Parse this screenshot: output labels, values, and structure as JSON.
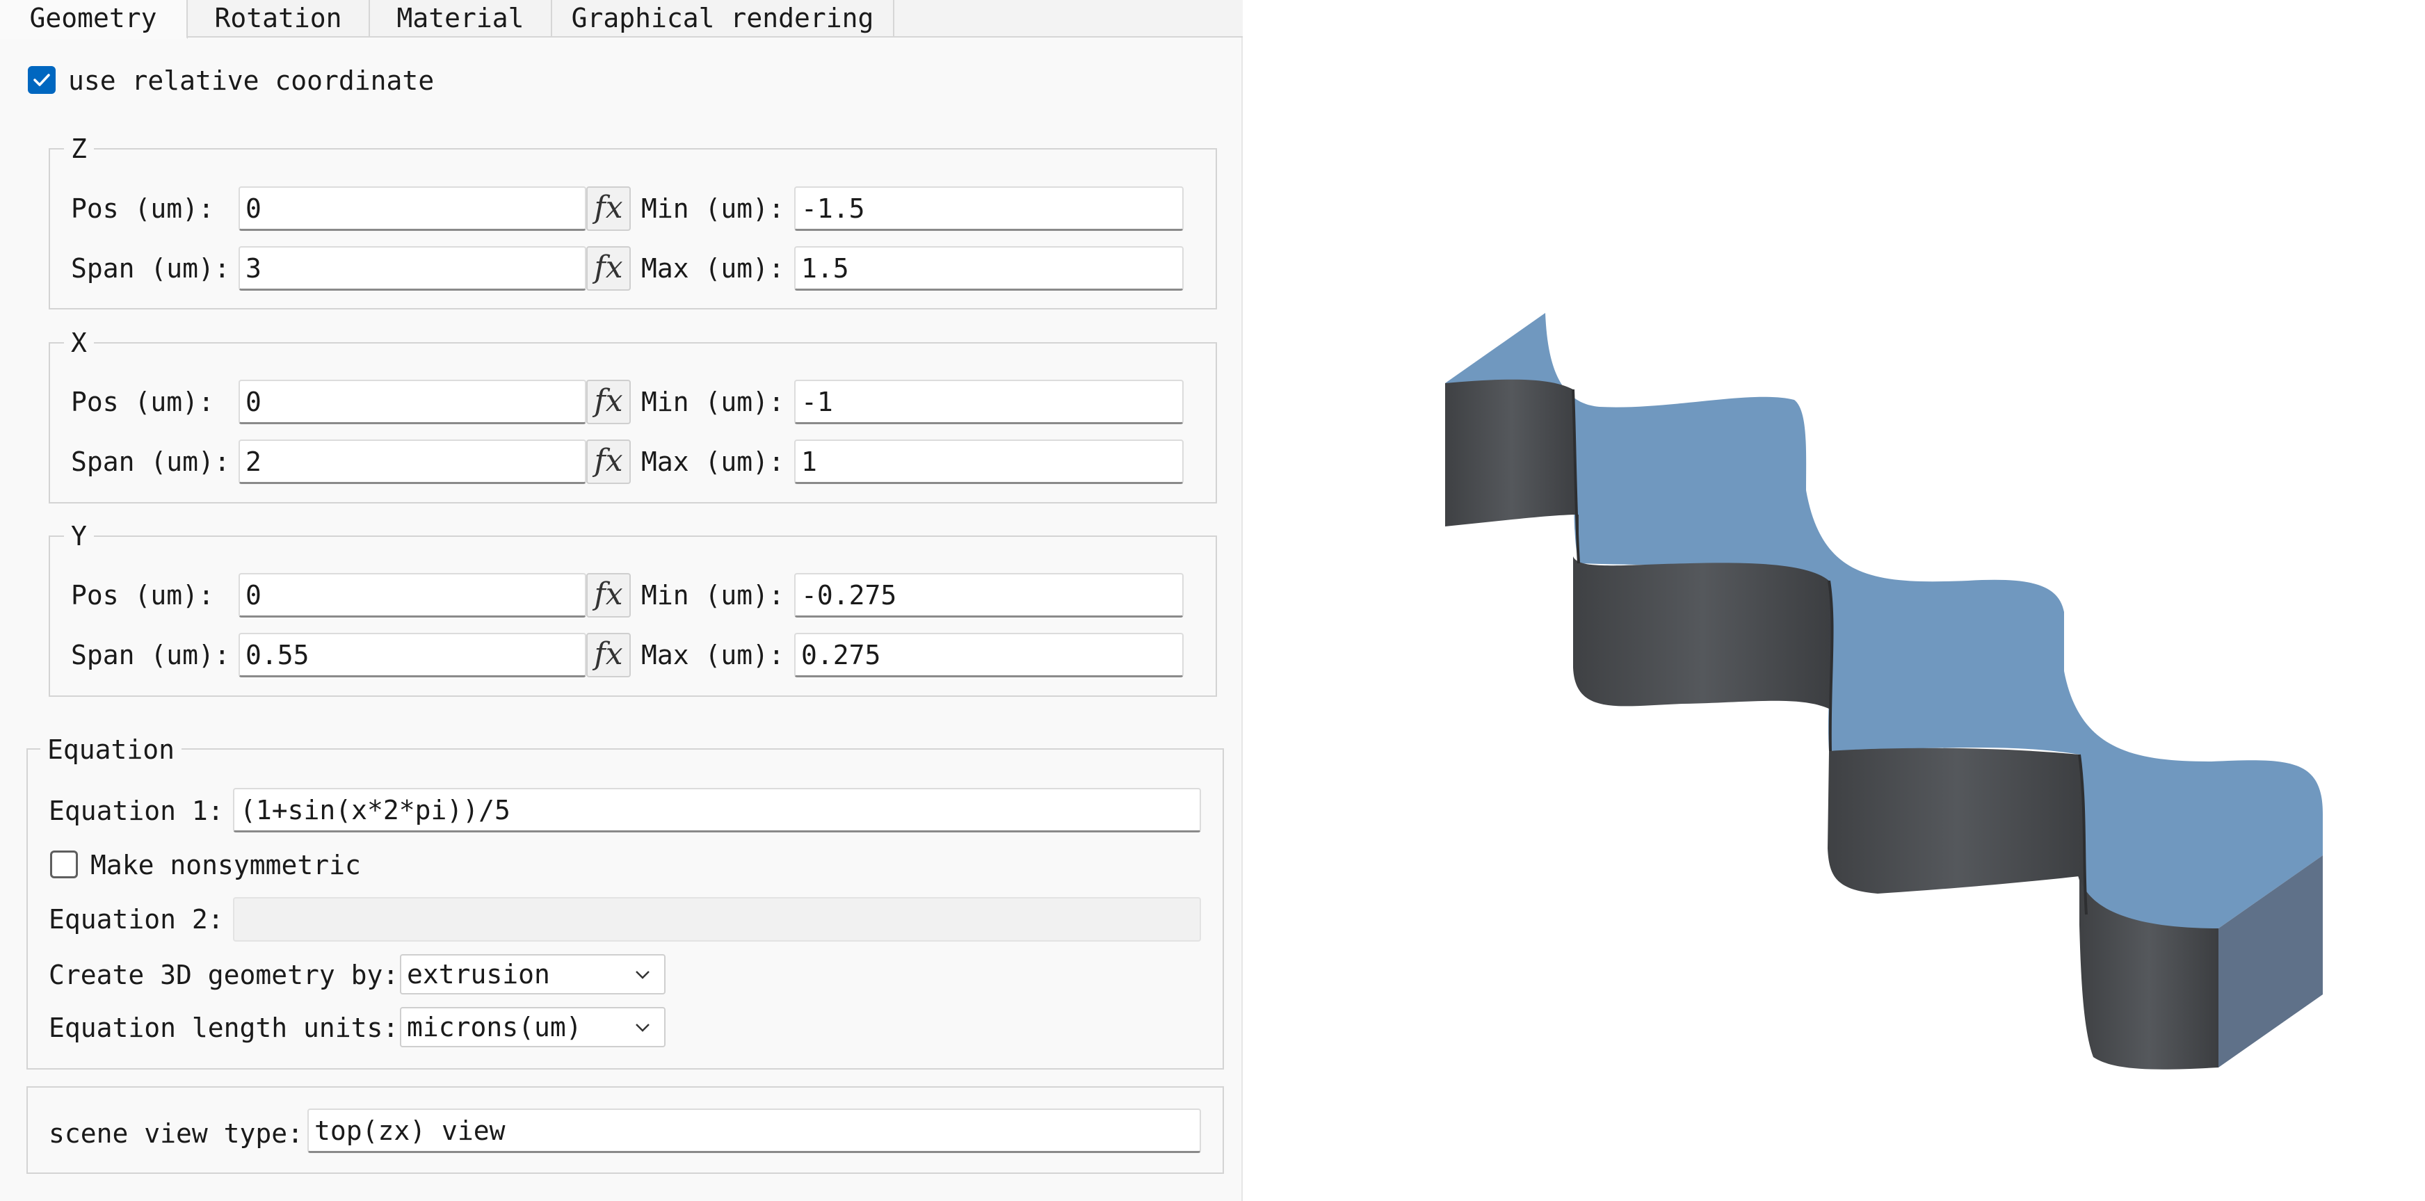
{
  "tabs": [
    "Geometry",
    "Rotation",
    "Material",
    "Graphical rendering"
  ],
  "options": {
    "use_relative_coordinate": {
      "label": "use relative coordinate",
      "checked": true
    }
  },
  "z_group": {
    "title": "Z",
    "pos_label": "Pos (um):",
    "pos_value": "0",
    "span_label": "Span (um):",
    "span_value": "3",
    "min_label": "Min (um):",
    "min_value": "-1.5",
    "max_label": "Max (um):",
    "max_value": "1.5"
  },
  "x_group": {
    "title": "X",
    "pos_label": "Pos (um):",
    "pos_value": "0",
    "span_label": "Span (um):",
    "span_value": "2",
    "min_label": "Min (um):",
    "min_value": "-1",
    "max_label": "Max (um):",
    "max_value": "1"
  },
  "y_group": {
    "title": "Y",
    "pos_label": "Pos (um):",
    "pos_value": "0",
    "span_label": "Span (um):",
    "span_value": "0.55",
    "min_label": "Min (um):",
    "min_value": "-0.275",
    "max_label": "Max (um):",
    "max_value": "0.275"
  },
  "fx_label": "fx",
  "equation": {
    "title": "Equation",
    "eq1_label": "Equation 1:",
    "eq1_value": "(1+sin(x*2*pi))/5",
    "nonsymmetric_label": "Make nonsymmetric",
    "nonsymmetric_checked": false,
    "eq2_label": "Equation 2:",
    "eq2_value": "",
    "create_label": "Create 3D geometry by:",
    "create_value": "extrusion",
    "units_label": "Equation length units:",
    "units_value": "microns(um)"
  },
  "scene": {
    "label": "scene view type:",
    "value": "top(zx) view"
  },
  "colors": {
    "accent": "#0067c0",
    "top_face": "#7098bf",
    "side_face_dark": "#4b4d50",
    "side_face_light": "#5f7189"
  },
  "icons": [
    "checkmark-icon",
    "chevron-down-icon",
    "fx-icon"
  ]
}
